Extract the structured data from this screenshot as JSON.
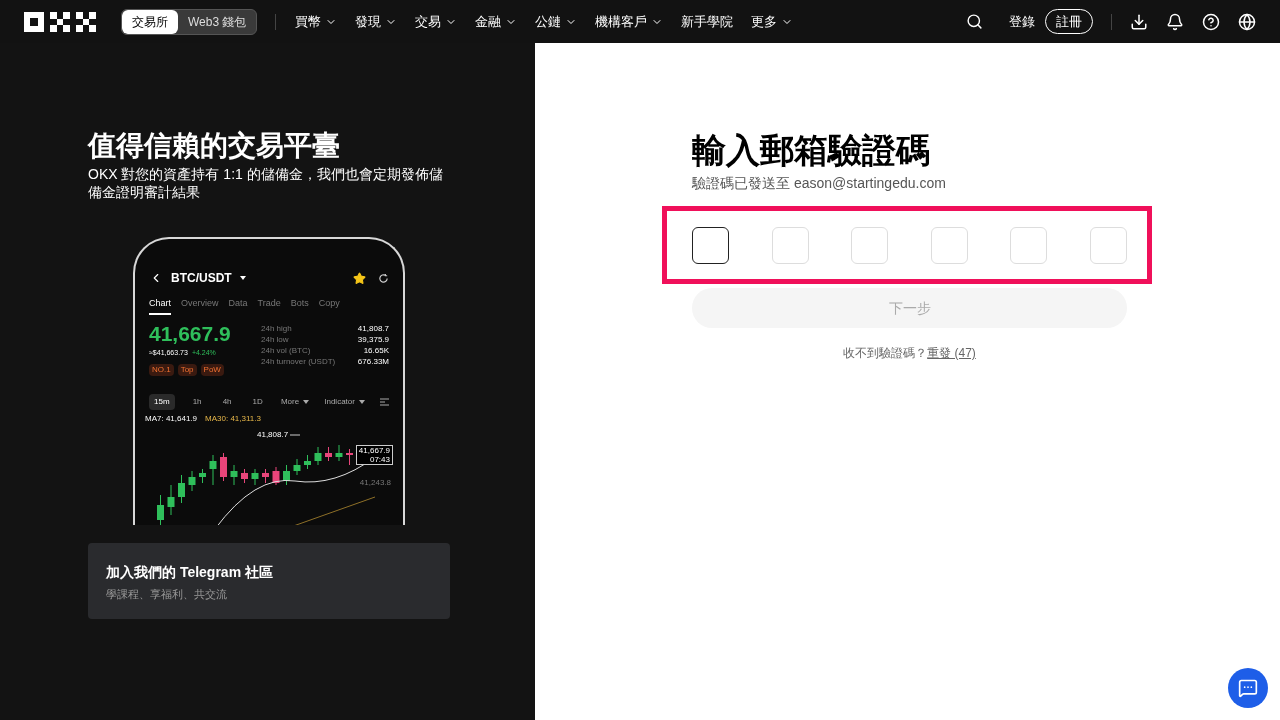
{
  "nav": {
    "mode_toggle": [
      {
        "label": "交易所",
        "selected": true
      },
      {
        "label": "Web3 錢包",
        "selected": false
      }
    ],
    "menu": [
      {
        "label": "買幣",
        "dropdown": true
      },
      {
        "label": "發現",
        "dropdown": true
      },
      {
        "label": "交易",
        "dropdown": true
      },
      {
        "label": "金融",
        "dropdown": true
      },
      {
        "label": "公鏈",
        "dropdown": true
      },
      {
        "label": "機構客戶",
        "dropdown": true
      },
      {
        "label": "新手學院",
        "dropdown": false
      },
      {
        "label": "更多",
        "dropdown": true
      }
    ],
    "login": "登錄",
    "register": "註冊"
  },
  "promo": {
    "title": "值得信賴的交易平臺",
    "subtitle": "OKX 對您的資產持有 1:1 的儲備金，我們也會定期發佈儲備金證明審計結果",
    "phone": {
      "pair": "BTC/USDT",
      "tabs": [
        {
          "label": "Chart",
          "selected": true
        },
        {
          "label": "Overview",
          "selected": false
        },
        {
          "label": "Data",
          "selected": false
        },
        {
          "label": "Trade",
          "selected": false
        },
        {
          "label": "Bots",
          "selected": false
        },
        {
          "label": "Copy",
          "selected": false
        }
      ],
      "price": "41,667.9",
      "fiat": "≈$41,663.73",
      "change": "+4.24%",
      "tags": [
        "NO.1",
        "Top",
        "PoW"
      ],
      "stats": [
        {
          "label": "24h high",
          "value": "41,808.7"
        },
        {
          "label": "24h low",
          "value": "39,375.9"
        },
        {
          "label": "24h vol (BTC)",
          "value": "16.65K"
        },
        {
          "label": "24h turnover (USDT)",
          "value": "676.33M"
        }
      ],
      "intervals": [
        {
          "label": "15m",
          "selected": true
        },
        {
          "label": "1h",
          "selected": false
        },
        {
          "label": "4h",
          "selected": false
        },
        {
          "label": "1D",
          "selected": false
        }
      ],
      "more": "More",
      "indicator": "Indicator",
      "ma7": "MA7: 41,641.9",
      "ma30": "MA30: 41,311.3",
      "high_marker": "41,808.7",
      "last_price": "41,667.9",
      "last_time": "07:43",
      "ma_marker": "41,243.8"
    },
    "community": {
      "title": "加入我們的 Telegram 社區",
      "subtitle": "學課程、享福利、共交流"
    }
  },
  "verify": {
    "title": "輸入郵箱驗證碼",
    "sent_to": "驗證碼已發送至 eason@startingedu.com",
    "code_boxes": [
      {
        "focused": true
      },
      {
        "focused": false
      },
      {
        "focused": false
      },
      {
        "focused": false
      },
      {
        "focused": false
      },
      {
        "focused": false
      }
    ],
    "next_button": {
      "label": "下一步",
      "disabled": true
    },
    "resend_prompt": "收不到驗證碼？",
    "resend_link": "重發 (47)"
  }
}
